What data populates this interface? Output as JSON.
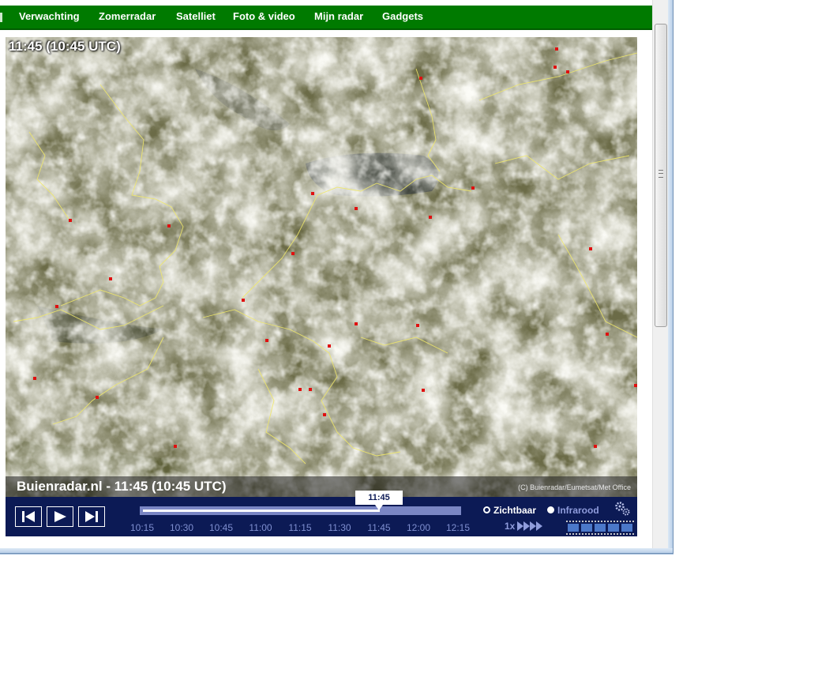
{
  "nav": {
    "items": [
      {
        "label": "Verwachting"
      },
      {
        "label": "Zomerradar"
      },
      {
        "label": "Satelliet"
      },
      {
        "label": "Foto & video"
      },
      {
        "label": "Mijn radar"
      },
      {
        "label": "Gadgets"
      }
    ],
    "color": "#007a00"
  },
  "viewer": {
    "overlay_time": "11:45 (10:45 UTC)",
    "caption": "Buienradar.nl - 11:45 (10:45 UTC)",
    "copyright": "(C) Buienradar/Eumetsat/Met Office",
    "current_time": "11:45",
    "progress": 0.75,
    "timeline_labels": [
      "10:15",
      "10:30",
      "10:45",
      "11:00",
      "11:15",
      "11:30",
      "11:45",
      "12:00",
      "12:15"
    ],
    "modes": {
      "visible": "Zichtbaar",
      "infrared": "Infrarood",
      "selected": "visible"
    },
    "speed": "1x",
    "background_color": "#0c1a55"
  },
  "icons": {
    "first": "skip-back-icon",
    "play": "play-icon",
    "last": "skip-forward-icon",
    "settings": "gear-icon",
    "speed": "fast-forward-icon"
  }
}
